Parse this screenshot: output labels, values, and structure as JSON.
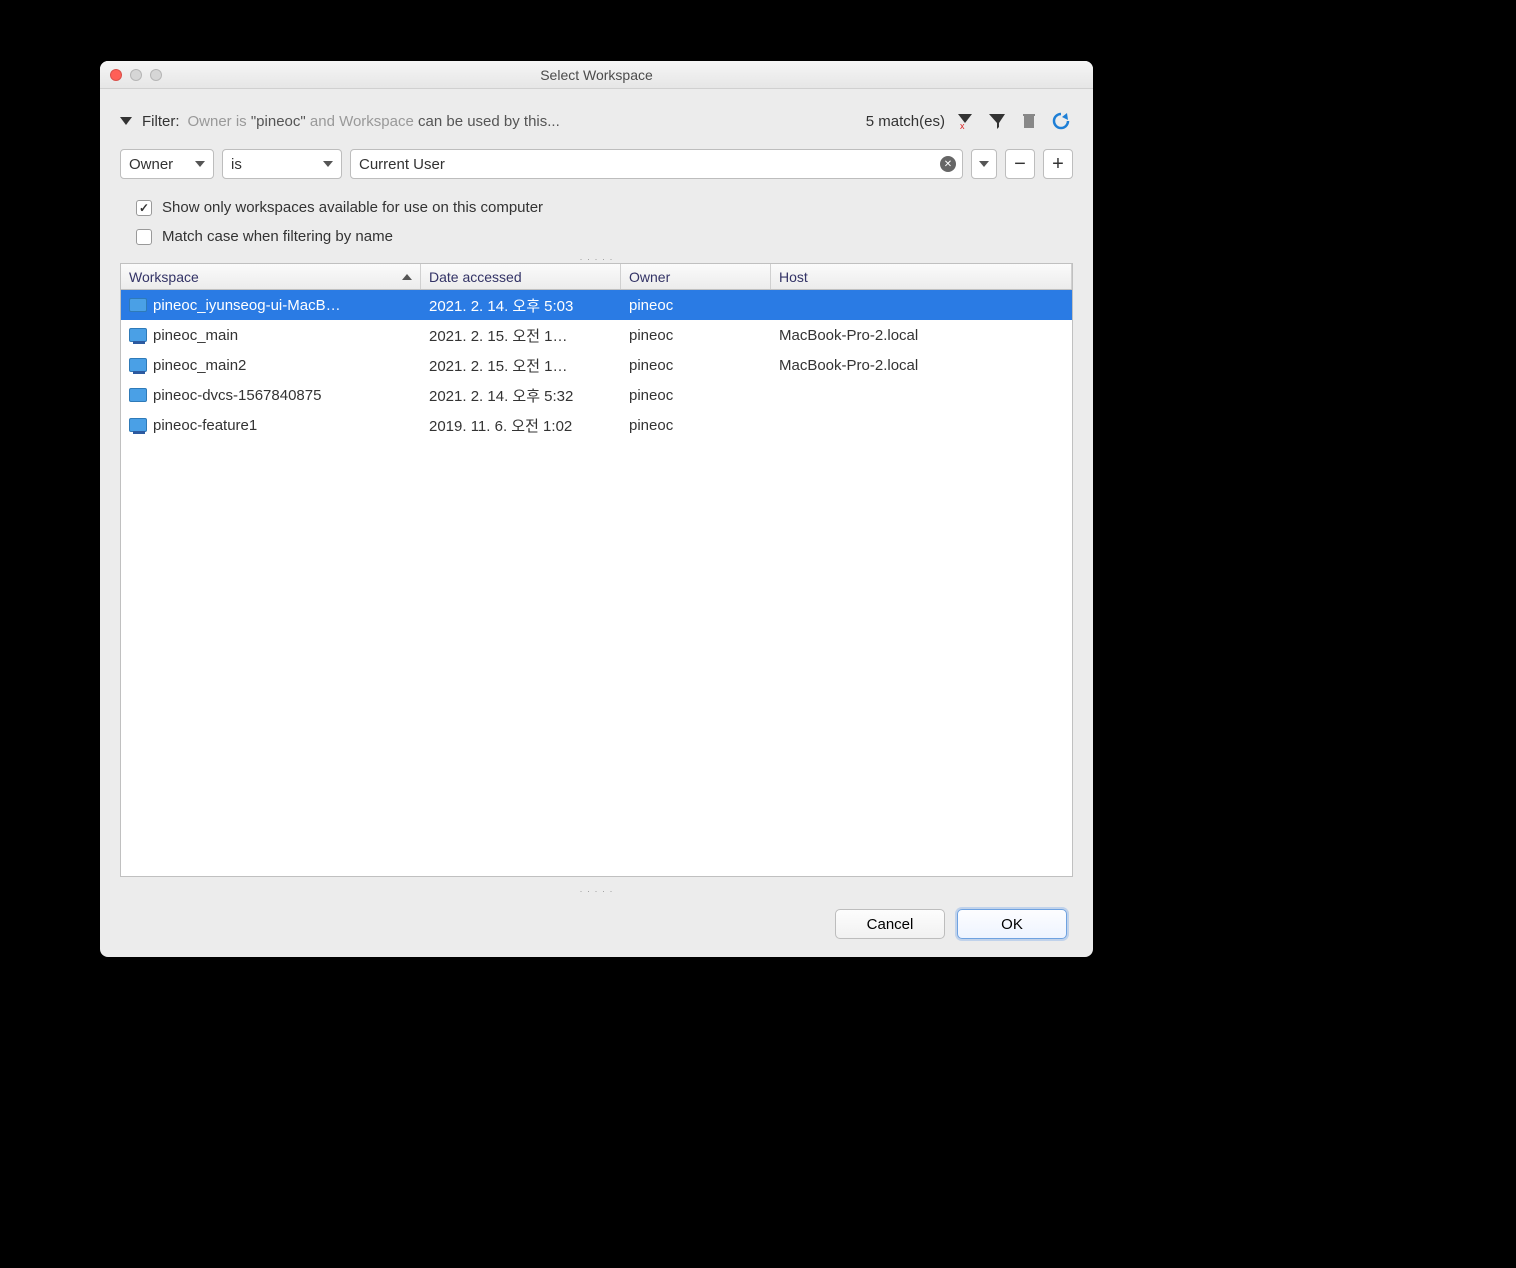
{
  "window": {
    "title": "Select Workspace"
  },
  "filter": {
    "label": "Filter:",
    "prefix": "Owner is ",
    "quoted": "\"pineoc\"",
    "mid_light": " and Workspace ",
    "suffix": "can be used by this...",
    "matches": "5 match(es)",
    "field": {
      "label": "Owner"
    },
    "op": {
      "label": "is"
    },
    "value": "Current User"
  },
  "checks": {
    "show_only": "Show only workspaces available for use on this computer",
    "match_case": "Match case when filtering by name"
  },
  "columns": {
    "workspace": "Workspace",
    "date": "Date accessed",
    "owner": "Owner",
    "host": "Host"
  },
  "rows": [
    {
      "name": "pineoc_iyunseog-ui-MacB…",
      "date": "2021. 2. 14. 오후 5:03",
      "owner": "pineoc",
      "host": "",
      "selected": true,
      "net": false
    },
    {
      "name": "pineoc_main",
      "date": "2021. 2. 15. 오전 1…",
      "owner": "pineoc",
      "host": "MacBook-Pro-2.local",
      "selected": false,
      "net": true
    },
    {
      "name": "pineoc_main2",
      "date": "2021. 2. 15. 오전 1…",
      "owner": "pineoc",
      "host": "MacBook-Pro-2.local",
      "selected": false,
      "net": true
    },
    {
      "name": "pineoc-dvcs-1567840875",
      "date": "2021. 2. 14. 오후 5:32",
      "owner": "pineoc",
      "host": "",
      "selected": false,
      "net": false
    },
    {
      "name": "pineoc-feature1",
      "date": "2019. 11. 6. 오전 1:02",
      "owner": "pineoc",
      "host": "",
      "selected": false,
      "net": true
    }
  ],
  "buttons": {
    "cancel": "Cancel",
    "ok": "OK"
  },
  "glyphs": {
    "minus": "−",
    "plus": "+"
  }
}
